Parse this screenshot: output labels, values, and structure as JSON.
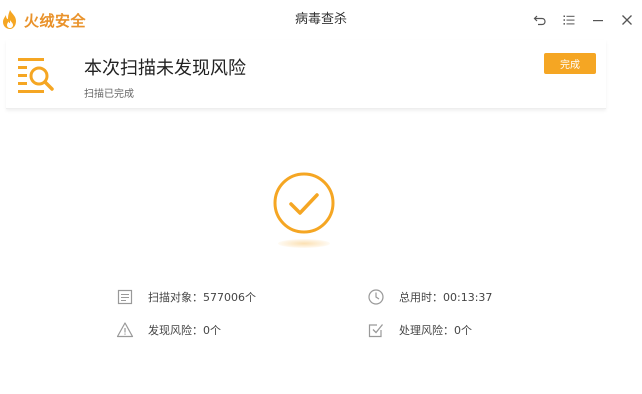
{
  "app": {
    "brand_name": "火绒安全",
    "window_title": "病毒查杀"
  },
  "window_controls": [
    {
      "name": "back-icon"
    },
    {
      "name": "menu-icon"
    },
    {
      "name": "minimize-icon"
    },
    {
      "name": "close-icon"
    }
  ],
  "header": {
    "title": "本次扫描未发现风险",
    "subtitle": "扫描已完成",
    "done_label": "完成"
  },
  "stats": {
    "scanned": "扫描对象：577006个",
    "time": "总用时：00:13:37",
    "found": "发现风险：0个",
    "handled": "处理风险：0个"
  },
  "colors": {
    "accent": "#f5a623",
    "brand": "#e9922a",
    "icon_gray": "#999999"
  }
}
